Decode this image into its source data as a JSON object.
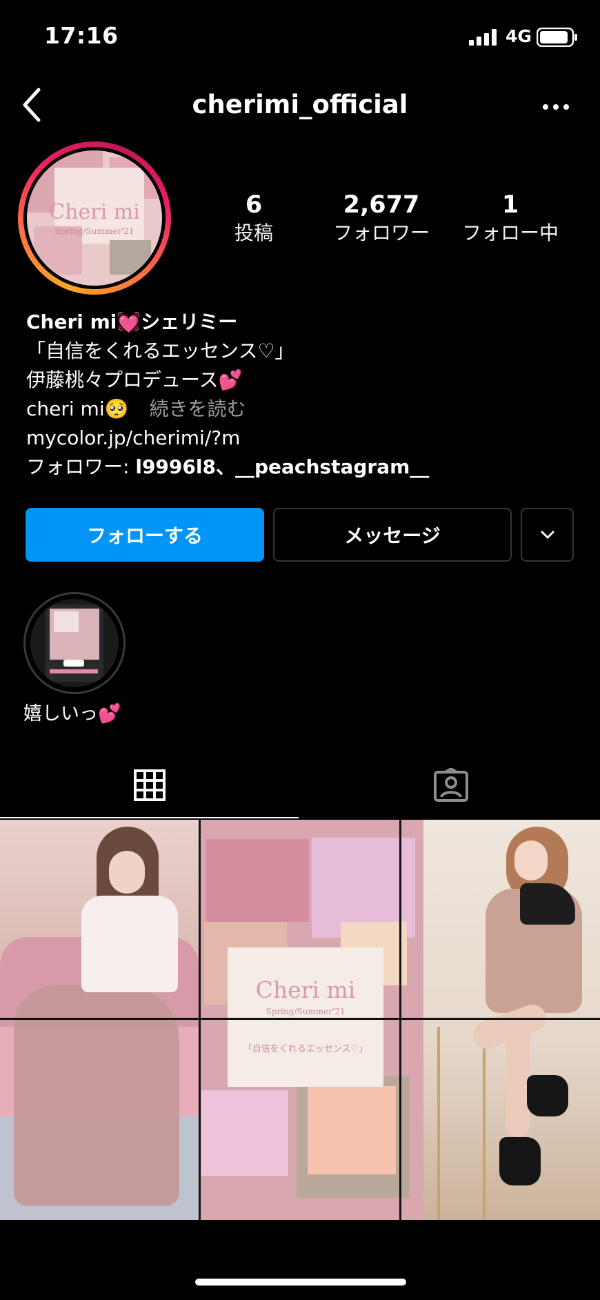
{
  "status_bar": {
    "time": "17:16",
    "network": "4G"
  },
  "header": {
    "username": "cherimi_official"
  },
  "avatar": {
    "logo": "Cheri mi",
    "subtitle": "Spring/Summer'21"
  },
  "stats": {
    "posts": {
      "value": "6",
      "label": "投稿"
    },
    "followers": {
      "value": "2,677",
      "label": "フォロワー"
    },
    "following": {
      "value": "1",
      "label": "フォロー中"
    }
  },
  "bio": {
    "name": "Cheri mi💓シェリミー",
    "line1": "「自信をくれるエッセンス♡」",
    "line2": "伊藤桃々プロデュース💕",
    "line3": "cheri mi🥺",
    "more": "続きを読む",
    "link": "mycolor.jp/cherimi/?m",
    "followed_by_prefix": "フォロワー: ",
    "followed_by_users": "l9996l8、__peachstagram__"
  },
  "buttons": {
    "follow": "フォローする",
    "message": "メッセージ"
  },
  "highlights": [
    {
      "label": "嬉しいっ💕"
    }
  ],
  "posts": {
    "post2": {
      "logo": "Cheri mi",
      "subtitle": "Spring/Summer'21",
      "tagline": "「自信をくれるエッセンス♡」"
    }
  },
  "icons": [
    "back-icon",
    "more-icon",
    "chevron-down-icon",
    "grid-icon",
    "tagged-icon",
    "signal-icon",
    "battery-icon"
  ],
  "colors": {
    "follow_button": "#0095f6",
    "background": "#000000"
  }
}
